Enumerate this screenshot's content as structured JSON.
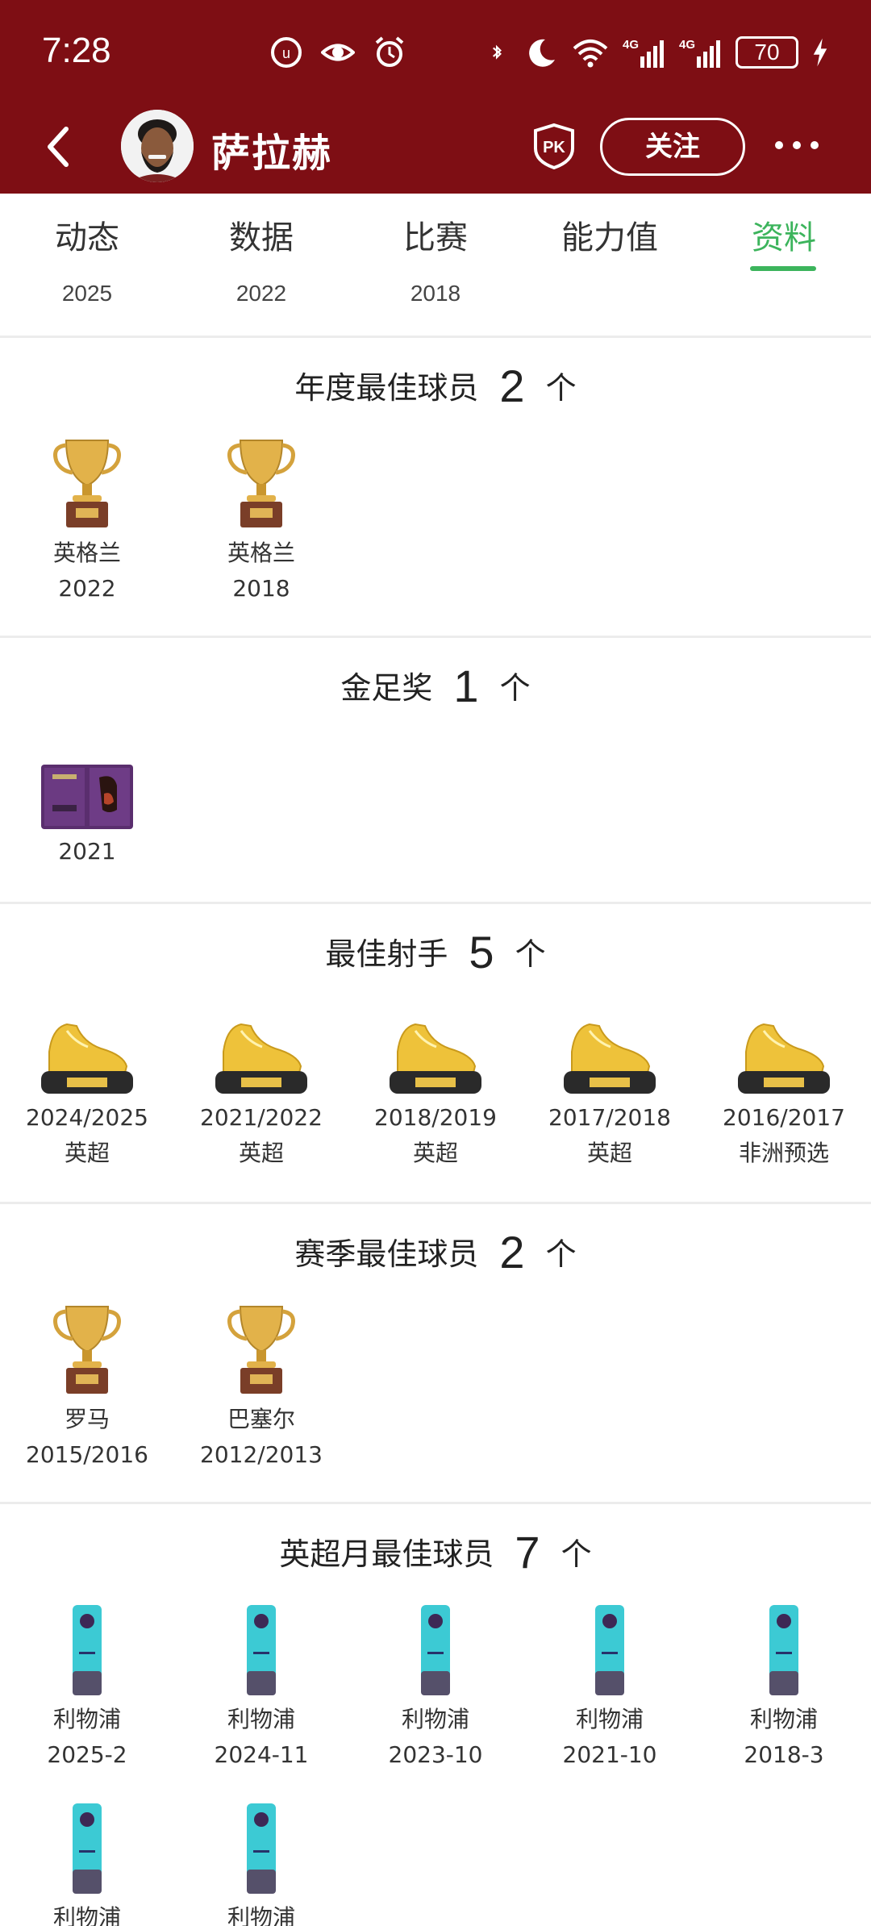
{
  "status_bar": {
    "time": "7:28",
    "battery": "70"
  },
  "header": {
    "player_name": "萨拉赫",
    "pk_label": "PK",
    "follow_label": "关注"
  },
  "tabs": [
    {
      "label": "动态",
      "year": "2025"
    },
    {
      "label": "数据",
      "year": "2022"
    },
    {
      "label": "比赛",
      "year": "2018"
    },
    {
      "label": "能力值",
      "year": ""
    },
    {
      "label": "资料",
      "year": ""
    }
  ],
  "sections": {
    "annual_best": {
      "title": "年度最佳球员",
      "count": "2",
      "unit": "个",
      "items": [
        {
          "line1": "英格兰",
          "line2": "2022"
        },
        {
          "line1": "英格兰",
          "line2": "2018"
        }
      ]
    },
    "golden_boot": {
      "title": "金足奖",
      "count": "1",
      "unit": "个",
      "items": [
        {
          "line1": "2021"
        }
      ]
    },
    "top_scorer": {
      "title": "最佳射手",
      "count": "5",
      "unit": "个",
      "items": [
        {
          "line1": "2024/2025",
          "line2": "英超"
        },
        {
          "line1": "2021/2022",
          "line2": "英超"
        },
        {
          "line1": "2018/2019",
          "line2": "英超"
        },
        {
          "line1": "2017/2018",
          "line2": "英超"
        },
        {
          "line1": "2016/2017",
          "line2": "非洲预选"
        }
      ]
    },
    "season_best": {
      "title": "赛季最佳球员",
      "count": "2",
      "unit": "个",
      "items": [
        {
          "line1": "罗马",
          "line2": "2015/2016"
        },
        {
          "line1": "巴塞尔",
          "line2": "2012/2013"
        }
      ]
    },
    "epl_month": {
      "title": "英超月最佳球员",
      "count": "7",
      "unit": "个",
      "items": [
        {
          "line1": "利物浦",
          "line2": "2025-2"
        },
        {
          "line1": "利物浦",
          "line2": "2024-11"
        },
        {
          "line1": "利物浦",
          "line2": "2023-10"
        },
        {
          "line1": "利物浦",
          "line2": "2021-10"
        },
        {
          "line1": "利物浦",
          "line2": "2018-3"
        },
        {
          "line1": "利物浦",
          "line2": ""
        },
        {
          "line1": "利物浦",
          "line2": ""
        }
      ]
    }
  },
  "colors": {
    "header_bg": "#7e0e14",
    "active_tab": "#3cb45c"
  }
}
